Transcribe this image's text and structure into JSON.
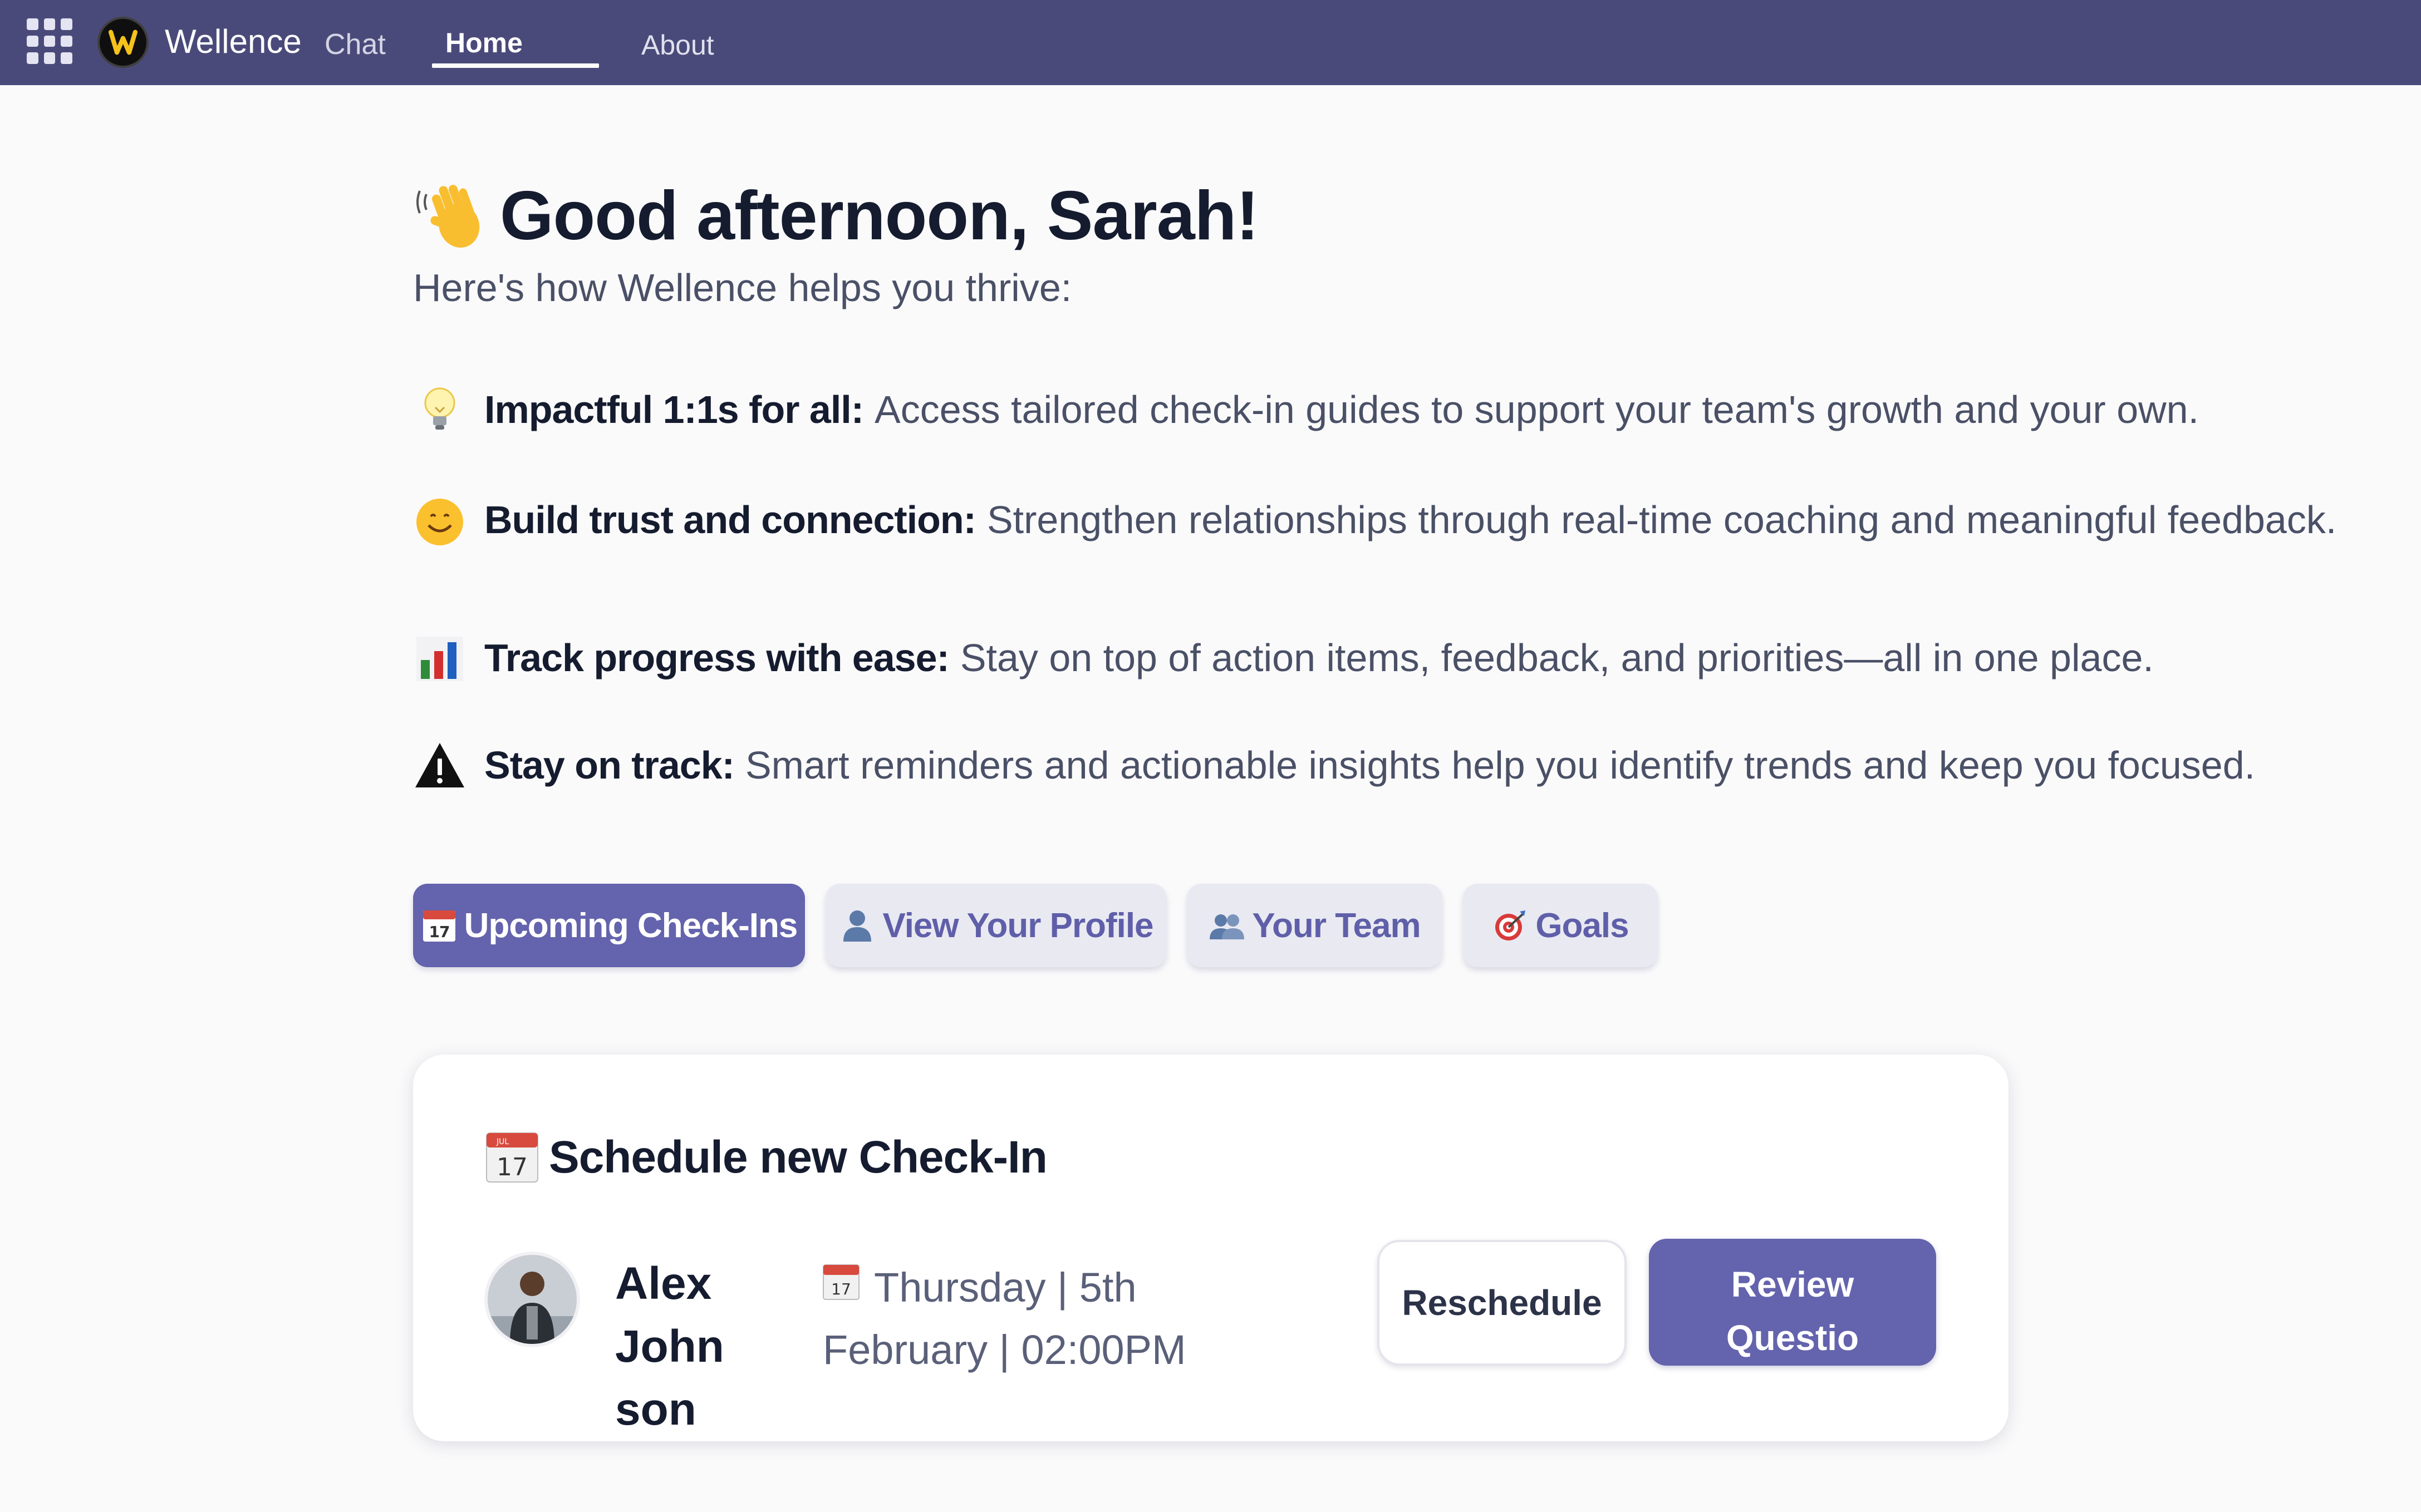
{
  "topbar": {
    "brand_name": "Wellence",
    "brand_sub": "Chat",
    "nav": [
      {
        "label": "Home",
        "active": true
      },
      {
        "label": "About",
        "active": false
      }
    ]
  },
  "greeting": {
    "title": "Good afternoon, Sarah!",
    "subtitle": "Here's how Wellence helps you thrive:"
  },
  "features": [
    {
      "icon": "lightbulb-icon",
      "title": "Impactful 1:1s for all:",
      "description": "Access tailored check-in guides to support your team's growth and your own."
    },
    {
      "icon": "smiley-icon",
      "title": "Build trust and connection:",
      "description": "Strengthen relationships through real-time coaching and meaningful feedback."
    },
    {
      "icon": "bar-chart-icon",
      "title": "Track progress with ease:",
      "description": "Stay on top of action items, feedback, and priorities—all in one place."
    },
    {
      "icon": "warning-icon",
      "title": "Stay on track:",
      "description": "Smart reminders and actionable insights help you identify trends and keep you focused."
    }
  ],
  "tabs": [
    {
      "icon": "calendar-icon",
      "label": "Upcoming Check-Ins",
      "active": true
    },
    {
      "icon": "person-icon",
      "label": "View Your Profile",
      "active": false
    },
    {
      "icon": "people-icon",
      "label": "Your Team",
      "active": false
    },
    {
      "icon": "target-icon",
      "label": "Goals",
      "active": false
    }
  ],
  "card": {
    "title": "Schedule new Check-In",
    "person_name": "Alex Johnson",
    "date_text": "Thursday | 5th February | 02:00PM",
    "calendar_icon_text": "17",
    "calendar_month": "JUL",
    "reschedule_label": "Reschedule",
    "review_label": "Review Questions"
  },
  "colors": {
    "topbar": "#4a4a7a",
    "accent": "#6463ad",
    "tab_inactive_bg": "#e9e9f2",
    "tab_inactive_text": "#5f5fa9"
  }
}
